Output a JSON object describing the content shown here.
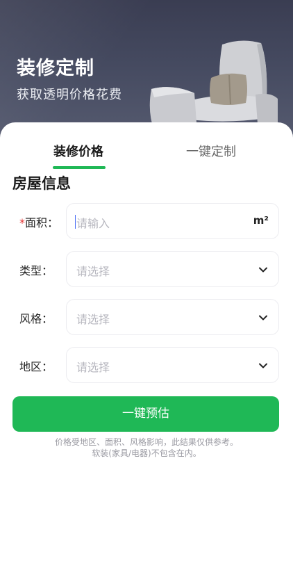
{
  "hero": {
    "title": "装修定制",
    "subtitle": "获取透明价格花费"
  },
  "tabs": [
    {
      "label": "装修价格",
      "active": true
    },
    {
      "label": "一键定制",
      "active": false
    }
  ],
  "section_title": "房屋信息",
  "form": {
    "area": {
      "label": "面积：",
      "required_mark": "*",
      "placeholder": "请输入",
      "unit": "m²"
    },
    "type": {
      "label": "类型：",
      "placeholder": "请选择"
    },
    "style": {
      "label": "风格：",
      "placeholder": "请选择"
    },
    "region": {
      "label": "地区：",
      "placeholder": "请选择"
    }
  },
  "cta_label": "一键预估",
  "notes": {
    "line1": "价格受地区、面积、风格影响，此结果仅供参考。",
    "line2": "软装(家具/电器)不包含在内。"
  },
  "colors": {
    "accent": "#1fb856",
    "hero_bg": "#3f4358",
    "required": "#e3312f"
  }
}
